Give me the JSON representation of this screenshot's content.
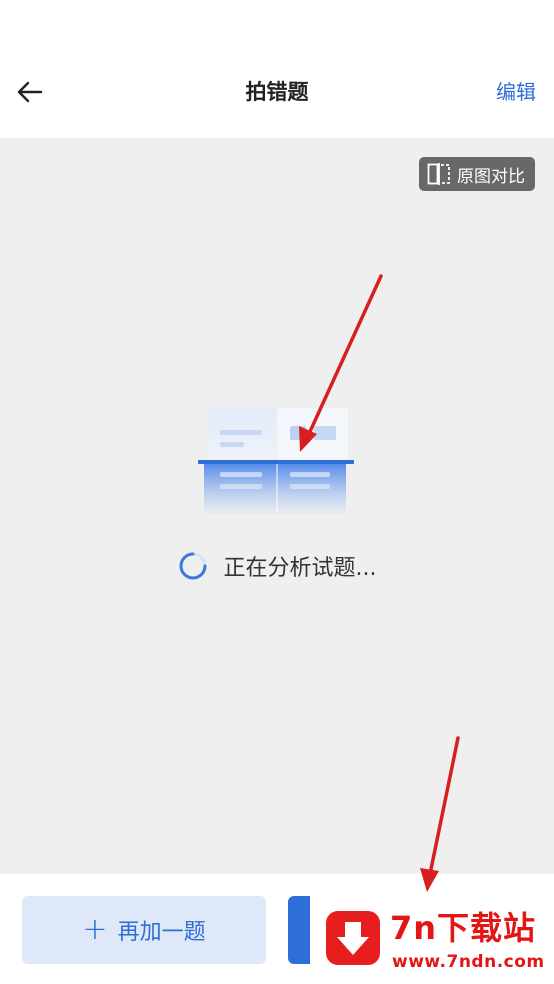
{
  "header": {
    "back_icon": "arrow-left-icon",
    "title": "拍错题",
    "edit_label": "编辑"
  },
  "content": {
    "compare_label": "原图对比",
    "compare_icon": "split-compare-icon",
    "illustration_icon": "document-scan-icon",
    "loading_text": "正在分析试题..."
  },
  "bottom_bar": {
    "add_label": "再加一题",
    "add_icon": "plus-icon"
  },
  "watermark": {
    "title": "7n下载站",
    "url": "www.7ndn.com",
    "logo_icon": "download-arrow-icon"
  },
  "colors": {
    "accent": "#2d6fd6",
    "content_bg": "#efefef",
    "annotation": "#d62020",
    "watermark": "#e31515"
  }
}
